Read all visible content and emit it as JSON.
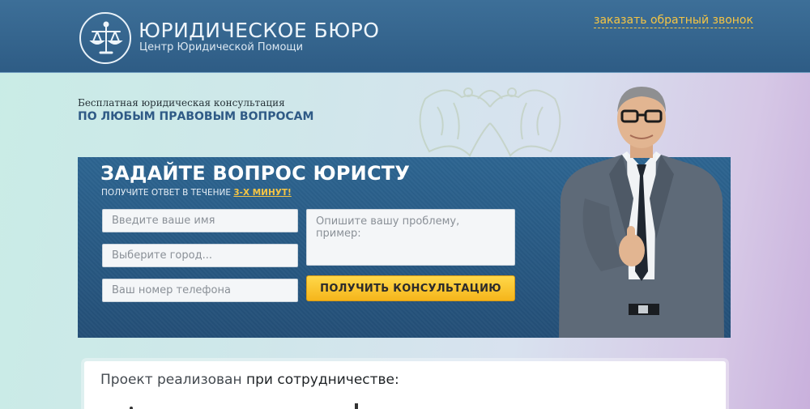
{
  "header": {
    "logo_title": "ЮРИДИЧЕСКОЕ БЮРО",
    "logo_subtitle": "Центр Юридической Помощи",
    "callback_link": "заказать обратный звонок",
    "logo_icon": "scales-of-justice-icon",
    "bg_color": "#2e5c85",
    "accent_color": "#f5c544"
  },
  "hero": {
    "small_text": "Бесплатная юридическая консультация",
    "big_text": "ПО ЛЮБЫМ ПРАВОВЫМ ВОПРОСАМ"
  },
  "form": {
    "title": "ЗАДАЙТЕ ВОПРОС ЮРИСТУ",
    "subtitle_prefix": "ПОЛУЧИТЕ ОТВЕТ В ТЕЧЕНИЕ ",
    "subtitle_highlight": "3-Х МИНУТ!",
    "name_placeholder": "Введите ваше имя",
    "city_placeholder": "Выберите город...",
    "phone_placeholder": "Ваш номер телефона",
    "problem_placeholder": "Опишите вашу проблему, пример:",
    "submit_label": "ПОЛУЧИТЬ КОНСУЛЬТАЦИЮ",
    "button_color": "#f5b51b"
  },
  "partners": {
    "text_prefix": "Проект реализован ",
    "text_strong": "при сотрудничестве:"
  }
}
